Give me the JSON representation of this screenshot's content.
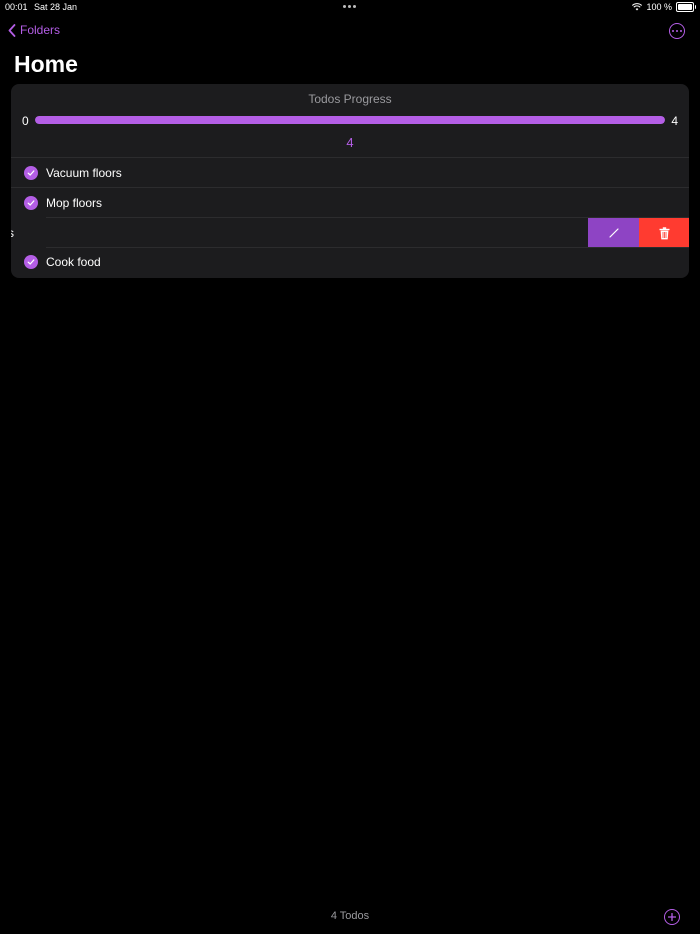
{
  "status_bar": {
    "time": "00:01",
    "date": "Sat 28 Jan",
    "battery": "100 %"
  },
  "nav": {
    "back_label": "Folders",
    "title": "Home"
  },
  "progress": {
    "title": "Todos Progress",
    "min": "0",
    "max": "4",
    "value": "4",
    "fraction": 1.0
  },
  "todos": [
    {
      "label": "Vacuum floors",
      "done": true
    },
    {
      "label": "Mop floors",
      "done": true
    },
    {
      "label": "s",
      "done": true,
      "swiped": true
    },
    {
      "label": "Cook food",
      "done": true
    }
  ],
  "footer": {
    "count_label": "4 Todos"
  },
  "colors": {
    "accent": "#b45ee6",
    "edit": "#8e44c4",
    "delete": "#ff3b30",
    "card": "#1c1c1e",
    "background": "#000000"
  },
  "icons": {
    "back": "chevron-left-icon",
    "more": "ellipsis-circle-icon",
    "check": "checkmark-circle-icon",
    "edit": "pencil-icon",
    "delete": "trash-icon",
    "add": "plus-circle-icon"
  }
}
